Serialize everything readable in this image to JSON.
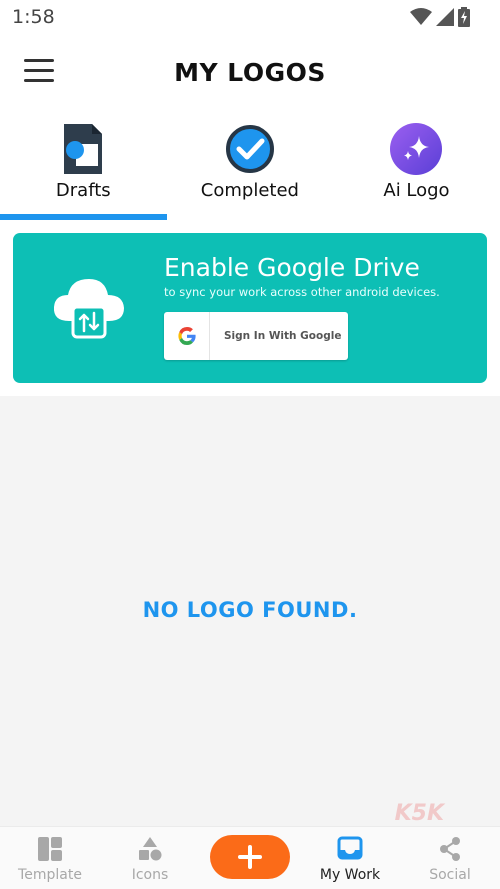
{
  "status_bar": {
    "time": "1:58",
    "icons": [
      "wifi-icon",
      "signal-icon",
      "battery-charging-icon"
    ]
  },
  "header": {
    "title": "MY LOGOS",
    "menu_icon": "hamburger-menu-icon"
  },
  "tabs": [
    {
      "label": "Drafts",
      "icon": "drafts-document-icon",
      "selected": true
    },
    {
      "label": "Completed",
      "icon": "check-circle-icon",
      "selected": false
    },
    {
      "label": "Ai Logo",
      "icon": "sparkles-icon",
      "selected": false
    }
  ],
  "drive_banner": {
    "title": "Enable Google Drive",
    "subtitle": "to sync your work across other android devices.",
    "button_label": "Sign In With Google",
    "icon": "cloud-sync-icon",
    "background_color": "#0dbfb5"
  },
  "empty_state": {
    "message": "NO LOGO FOUND."
  },
  "watermark": "K5K",
  "bottom_nav": {
    "items": [
      {
        "label": "Template",
        "icon": "template-grid-icon",
        "active": false
      },
      {
        "label": "Icons",
        "icon": "shapes-icon",
        "active": false
      },
      {
        "label": "My Work",
        "icon": "inbox-tray-icon",
        "active": true
      },
      {
        "label": "Social",
        "icon": "share-icon",
        "active": false
      }
    ],
    "fab_icon": "plus-icon"
  },
  "colors": {
    "accent_blue": "#1e95ee",
    "fab_orange": "#fb6b18",
    "teal": "#0dbfb5",
    "ai_purple": "#7b4fe0"
  }
}
